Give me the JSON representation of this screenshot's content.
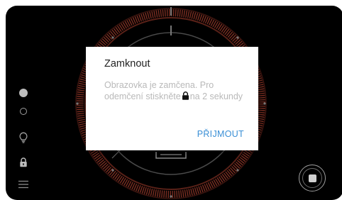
{
  "dialog": {
    "title": "Zamknout",
    "message_before_icon": "Obrazovka je zamčena. Pro odemčení stiskněte",
    "message_icon": "lock-icon",
    "message_after_icon": "na 2 sekundy",
    "accept_label": "PŘIJMOUT"
  },
  "sidebar": {
    "items": [
      {
        "icon": "record-dot-icon"
      },
      {
        "icon": "circle-outline-icon"
      },
      {
        "icon": "lightbulb-icon"
      },
      {
        "icon": "lock-icon"
      },
      {
        "icon": "menu-icon"
      }
    ]
  },
  "controls": {
    "stop_icon": "stop-icon"
  },
  "colors": {
    "device_background": "#000000",
    "dial_ring": "#7a2e22",
    "accent_button_text": "#3a8fd6",
    "dialog_background": "#ffffff",
    "dialog_message_text": "#b9b9b9"
  }
}
